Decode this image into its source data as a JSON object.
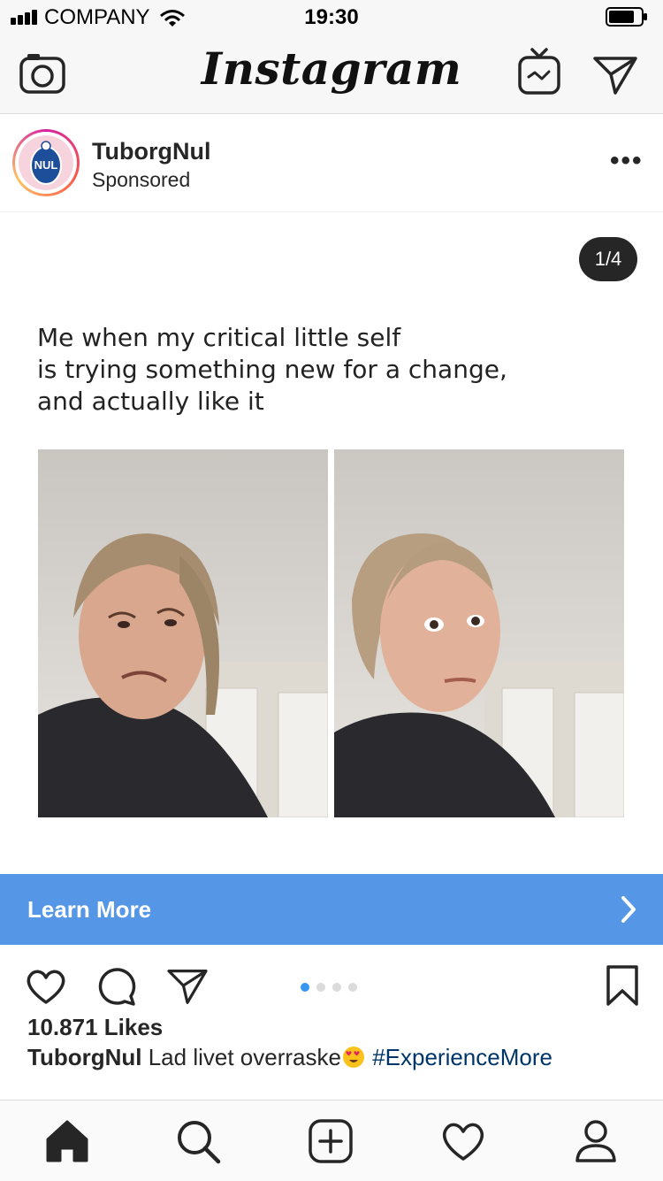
{
  "status_bar": {
    "carrier": "COMPANY",
    "time": "19:30"
  },
  "nav": {
    "logo": "Instagram",
    "icons": [
      "camera-icon",
      "igtv-icon",
      "direct-message-icon"
    ]
  },
  "post": {
    "username": "TuborgNul",
    "sponsored_label": "Sponsored",
    "avatar_text": "NUL",
    "more_label": "•••",
    "slide_counter": "1/4",
    "slide_index": 1,
    "slide_total": 4,
    "image_text": [
      "Me when my critical little self",
      "is trying something new for a change,",
      "and actually like it"
    ],
    "cta_label": "Learn More",
    "likes": "10.871 Likes",
    "caption_user": "TuborgNul",
    "caption_text": "Lad livet overraske",
    "caption_hashtag": "#ExperienceMore"
  },
  "colors": {
    "cta": "#5596e6",
    "active_dot": "#3897f0",
    "hashtag": "#003569"
  },
  "tabbar": {
    "icons": [
      "home-icon",
      "search-icon",
      "add-post-icon",
      "activity-heart-icon",
      "profile-icon"
    ]
  }
}
